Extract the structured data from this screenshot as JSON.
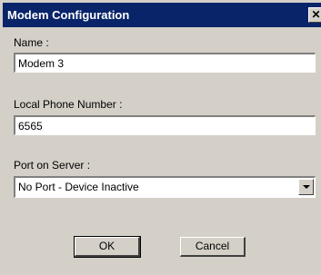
{
  "window": {
    "title": "Modem Configuration",
    "close_glyph": "✕"
  },
  "fields": {
    "name_label": "Name :",
    "name_value": "Modem 3",
    "phone_label": "Local Phone Number :",
    "phone_value": "6565",
    "port_label": "Port on Server :",
    "port_value": "No Port - Device Inactive"
  },
  "buttons": {
    "ok": "OK",
    "cancel": "Cancel"
  },
  "colors": {
    "titlebar": "#0a246a",
    "dialog_bg": "#d4d0c8"
  }
}
